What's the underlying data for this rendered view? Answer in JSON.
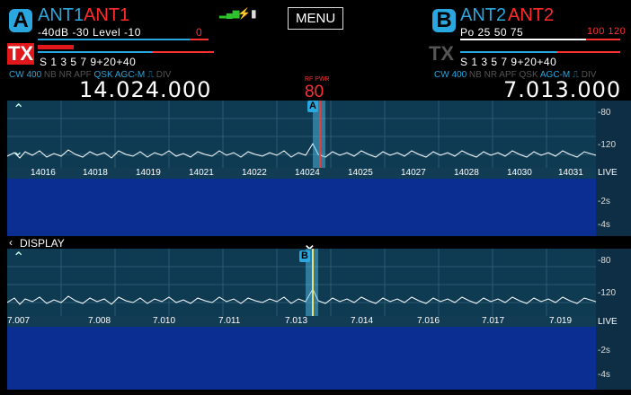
{
  "vfo_a": {
    "letter": "A",
    "ant1": "ANT1",
    "ant2": "ANT1",
    "scale_top": "-40dB -30  Level  -10",
    "scale_top_red": "0",
    "tx": "TX",
    "s_scale": "S  1   3  5  7  9+20+40",
    "mode": "CW",
    "bw": "400",
    "flags": [
      "NB",
      "NR",
      "APF"
    ],
    "flags_on": [
      "QSK",
      "AGC-M"
    ],
    "div": "DIV",
    "frequency": "14.024.000"
  },
  "vfo_b": {
    "letter": "B",
    "ant1": "ANT2",
    "ant2": "ANT2",
    "scale_top": "Po  25   50   75",
    "scale_top_red": "100 120",
    "tx": "TX",
    "s_scale": "S  1   3  5  7   9+20+40",
    "mode": "CW",
    "bw": "400",
    "flags": [
      "NB",
      "NR",
      "APF",
      "QSK"
    ],
    "flags_on": [
      "AGC-M"
    ],
    "div": "DIV",
    "frequency": "7.013.000"
  },
  "menu_label": "MENU",
  "rf_power": {
    "label": "RF PWR",
    "value": "80"
  },
  "panadapter_a": {
    "marker": "A",
    "ticks": [
      "14016",
      "14018",
      "14019",
      "14021",
      "14022",
      "14024",
      "14025",
      "14027",
      "14028",
      "14030",
      "14031"
    ],
    "right_scale": [
      "-80",
      "-120"
    ],
    "live": "LIVE",
    "wf_scale": [
      "-2s",
      "-4s"
    ]
  },
  "display_label": "DISPLAY",
  "panadapter_b": {
    "marker": "B",
    "ticks": [
      "7.007",
      "7.008",
      "7.010",
      "7.011",
      "7.013",
      "7.014",
      "7.016",
      "7.017",
      "7.019"
    ],
    "right_scale": [
      "-80",
      "-120"
    ],
    "live": "LIVE",
    "wf_scale": [
      "-2s",
      "-4s"
    ]
  },
  "colors": {
    "accent": "#2aa7de",
    "red": "#ff2a2a",
    "waterfall": "#0b2e93",
    "panel": "#0e3a52"
  }
}
